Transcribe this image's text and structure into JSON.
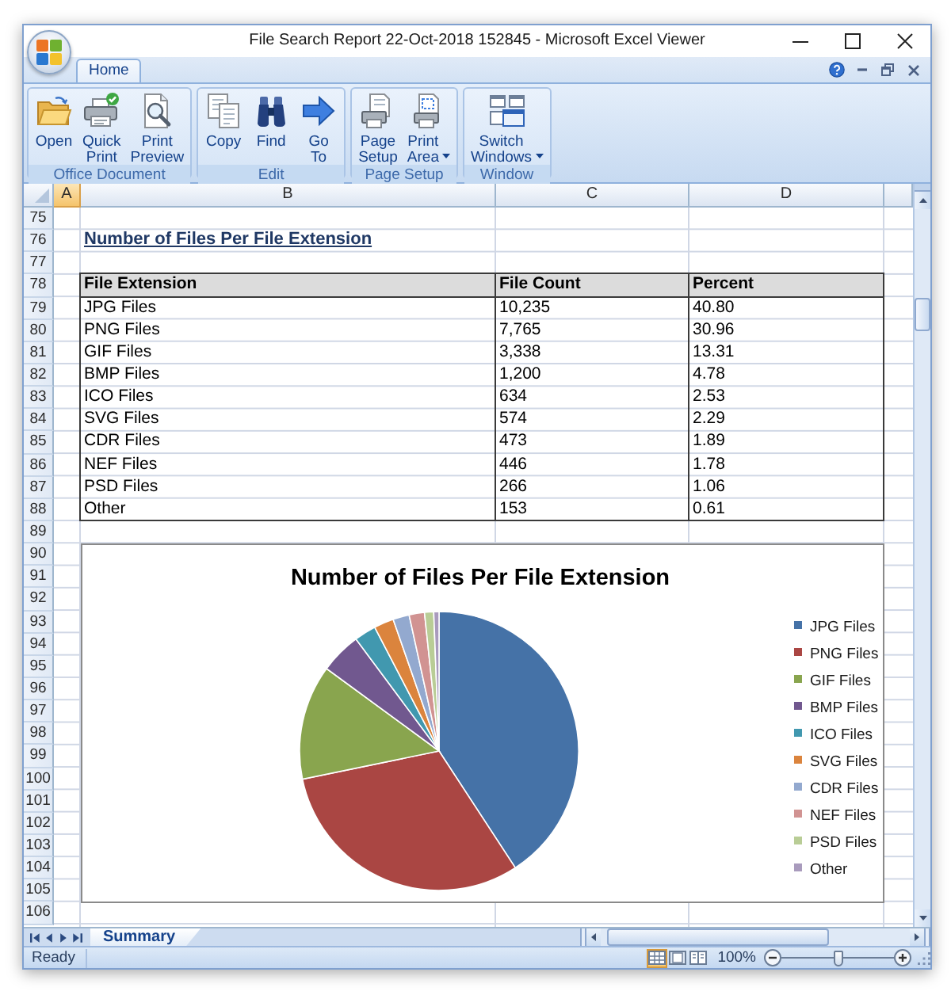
{
  "window": {
    "title": "File Search Report 22-Oct-2018 152845 - Microsoft Excel Viewer"
  },
  "ribbon": {
    "tabs": [
      {
        "label": "Home",
        "selected": true
      }
    ],
    "groups": [
      {
        "label": "Office Document",
        "buttons": [
          {
            "label": "Open",
            "dropdown": false
          },
          {
            "label": "Quick Print",
            "dropdown": false
          },
          {
            "label": "Print Preview",
            "dropdown": false
          }
        ]
      },
      {
        "label": "Edit",
        "buttons": [
          {
            "label": "Copy",
            "dropdown": false
          },
          {
            "label": "Find",
            "dropdown": false
          },
          {
            "label": "Go To",
            "dropdown": false
          }
        ]
      },
      {
        "label": "Page Setup",
        "buttons": [
          {
            "label": "Page Setup",
            "dropdown": false
          },
          {
            "label": "Print Area",
            "dropdown": true
          }
        ]
      },
      {
        "label": "Window",
        "buttons": [
          {
            "label": "Switch Windows",
            "dropdown": true
          }
        ]
      }
    ]
  },
  "sheet": {
    "column_headers": [
      {
        "label": "A",
        "selected": true
      },
      {
        "label": "B",
        "selected": false
      },
      {
        "label": "C",
        "selected": false
      },
      {
        "label": "D",
        "selected": false
      }
    ],
    "row_numbers": [
      "75",
      "76",
      "77",
      "78",
      "79",
      "80",
      "81",
      "82",
      "83",
      "84",
      "85",
      "86",
      "87",
      "88",
      "89",
      "90",
      "91",
      "92",
      "93",
      "94",
      "95",
      "96",
      "97",
      "98",
      "99",
      "100",
      "101",
      "102",
      "103",
      "104",
      "105",
      "106"
    ],
    "heading": "Number of Files Per File Extension",
    "table": {
      "columns": [
        "File Extension",
        "File Count",
        "Percent"
      ],
      "rows": [
        [
          "JPG Files",
          "10,235",
          "40.80"
        ],
        [
          "PNG Files",
          "7,765",
          "30.96"
        ],
        [
          "GIF Files",
          "3,338",
          "13.31"
        ],
        [
          "BMP Files",
          "1,200",
          "4.78"
        ],
        [
          "ICO Files",
          "634",
          "2.53"
        ],
        [
          "SVG Files",
          "574",
          "2.29"
        ],
        [
          "CDR Files",
          "473",
          "1.89"
        ],
        [
          "NEF Files",
          "446",
          "1.78"
        ],
        [
          "PSD Files",
          "266",
          "1.06"
        ],
        [
          "Other",
          "153",
          "0.61"
        ]
      ]
    },
    "chart": {
      "chart_data": {
        "type": "pie",
        "title": "Number of Files Per File Extension",
        "categories": [
          "JPG Files",
          "PNG Files",
          "GIF Files",
          "BMP Files",
          "ICO Files",
          "SVG Files",
          "CDR Files",
          "NEF Files",
          "PSD Files",
          "Other"
        ],
        "values": [
          40.8,
          30.96,
          13.31,
          4.78,
          2.53,
          2.29,
          1.89,
          1.78,
          1.06,
          0.61
        ],
        "legend": "right"
      },
      "slices": [
        {
          "color": "#4572a7"
        },
        {
          "color": "#aa4643"
        },
        {
          "color": "#89a54e"
        },
        {
          "color": "#71588f"
        },
        {
          "color": "#4198af"
        },
        {
          "color": "#db843d"
        },
        {
          "color": "#93a9cf"
        },
        {
          "color": "#d19392"
        },
        {
          "color": "#b9cd96"
        },
        {
          "color": "#a99bbd"
        }
      ]
    }
  },
  "sheet_tabs": [
    {
      "label": "Summary",
      "selected": true
    }
  ],
  "status_bar": {
    "text": "Ready",
    "view_buttons": [
      {
        "selected": true
      },
      {
        "selected": false
      },
      {
        "selected": false
      }
    ],
    "zoom": "100%",
    "zoom_slider": {
      "level": 0.5
    }
  }
}
